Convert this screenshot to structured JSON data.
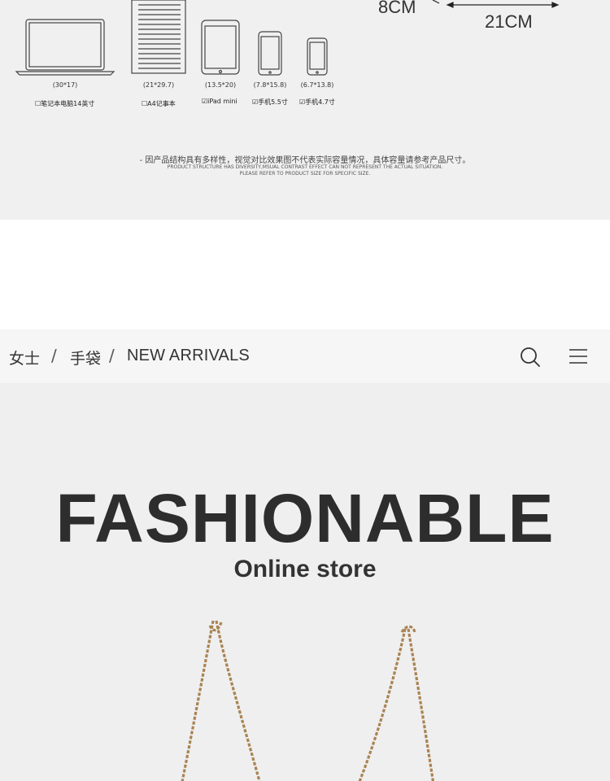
{
  "size_image": {
    "dimension_height": "8CM",
    "dimension_width": "21CM",
    "devices": [
      {
        "size": "(30*17)",
        "label": "笔记本电脑14英寸",
        "fits": false,
        "icon": "laptop-icon"
      },
      {
        "size": "(21*29.7)",
        "label": "A4记事本",
        "fits": false,
        "icon": "notebook-icon"
      },
      {
        "size": "(13.5*20)",
        "label": "iPad mini",
        "fits": true,
        "icon": "tablet-icon"
      },
      {
        "size": "(7.8*15.8)",
        "label": "手机5.5寸",
        "fits": true,
        "icon": "phone-icon"
      },
      {
        "size": "(6.7*13.8)",
        "label": "手机4.7寸",
        "fits": true,
        "icon": "phone-icon"
      }
    ],
    "note_cn": "- 因产品结构具有多样性，视觉对比效果图不代表实际容量情况，具体容量请参考产品尺寸。",
    "note_en_1": "PRODUCT STRUCTURE HAS DIVERSITY,MSUAL CONTRAST EFFECT CAN NOT REPRESENT THE ACTUAL SITUATION.",
    "note_en_2": "PLEASE REFER TO PRODUCT SIZE FOR SPECIFIC SIZE."
  },
  "breadcrumb": {
    "items": [
      "女士",
      "手袋",
      "NEW ARRIVALS"
    ],
    "separator": "/"
  },
  "header_icons": [
    "search-icon",
    "menu-icon"
  ],
  "hero": {
    "title": "FASHIONABLE",
    "subtitle": "Online store"
  },
  "colors": {
    "panel_bg": "#f0f0f0",
    "breadcrumb_bg": "#f6f6f6",
    "hero_bg": "#efefef",
    "title": "#2d2d2d",
    "chain": "#b08a56"
  }
}
